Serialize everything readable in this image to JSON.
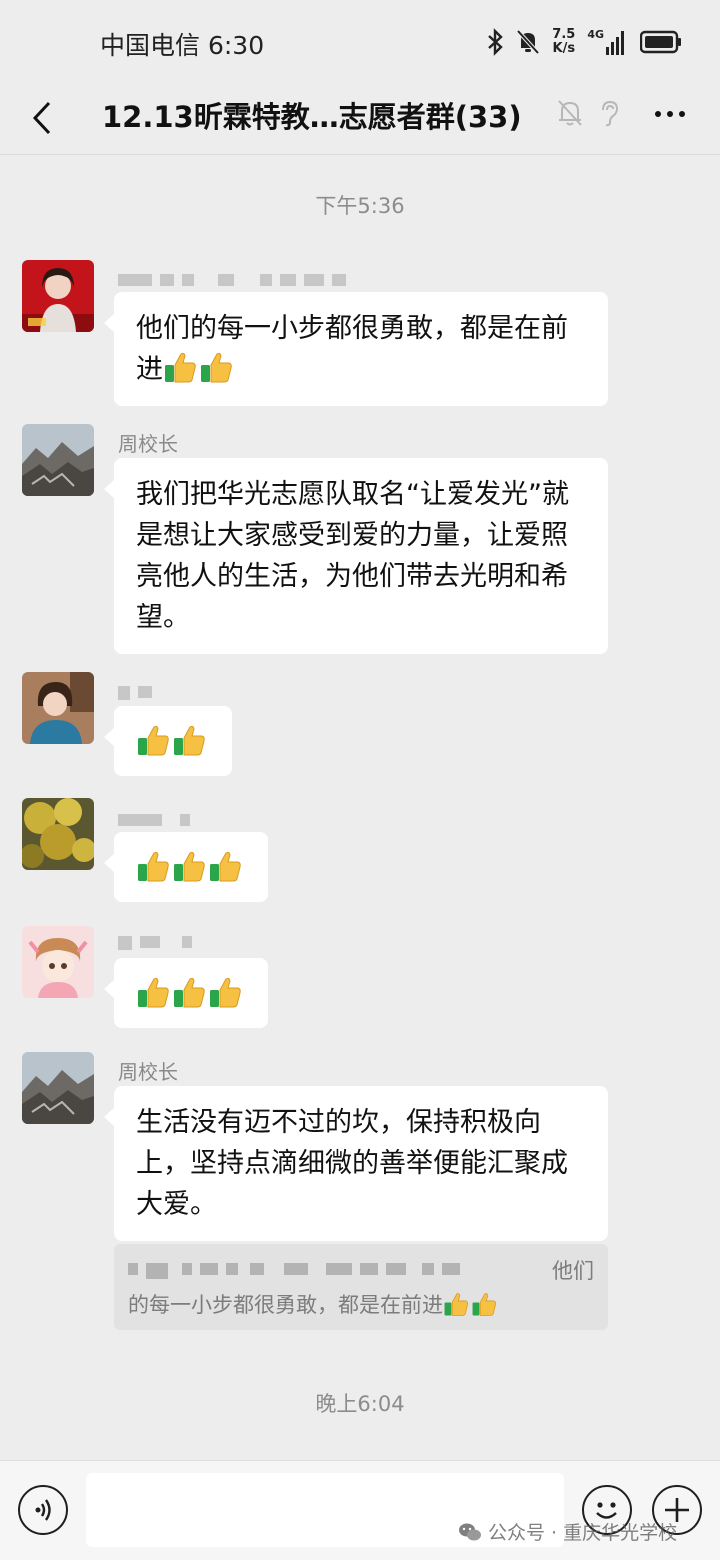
{
  "status_bar": {
    "carrier": "中国电信",
    "time": "6:30",
    "net_speed_value": "7.5",
    "net_speed_unit": "K/s",
    "net_type": "4G",
    "icons": [
      "bluetooth-icon",
      "mute-icon",
      "signal-icon",
      "battery-icon"
    ]
  },
  "header": {
    "title": "12.13昕霖特教…志愿者群(33)",
    "icons": [
      "back-icon",
      "mute-bell-icon",
      "earpiece-icon",
      "more-icon"
    ]
  },
  "messages_area": {
    "time_1": "下午5:36",
    "time_2": "晚上6:04",
    "messages": [
      {
        "sender": "",
        "text": "他们的每一小步都很勇敢，都是在前进",
        "thumbs": 2
      },
      {
        "sender": "周校长",
        "text": "我们把华光志愿队取名“让爱发光”就是想让大家感受到爱的力量，让爱照亮他人的生活，为他们带去光明和希望。"
      },
      {
        "sender": "",
        "text": "",
        "thumbs": 2
      },
      {
        "sender": "",
        "text": "",
        "thumbs": 3
      },
      {
        "sender": "",
        "text": "",
        "thumbs": 3
      },
      {
        "sender": "周校长",
        "text": "生活没有迈不过的坎，保持积极向上，坚持点滴细微的善举便能汇聚成大爱。"
      }
    ],
    "quote": {
      "line1_tail": "他们",
      "line2": "的每一小步都很勇敢，都是在前进"
    }
  },
  "input_bar": {
    "placeholder": "",
    "icons": [
      "voice-icon",
      "emoji-icon",
      "plus-icon"
    ]
  },
  "watermark": {
    "text": "公众号 · 重庆华光学校"
  },
  "colors": {
    "background": "#ededed",
    "bubble": "#ffffff",
    "timestamp": "#8c8c8c",
    "sender_name": "#8a8a8a"
  }
}
